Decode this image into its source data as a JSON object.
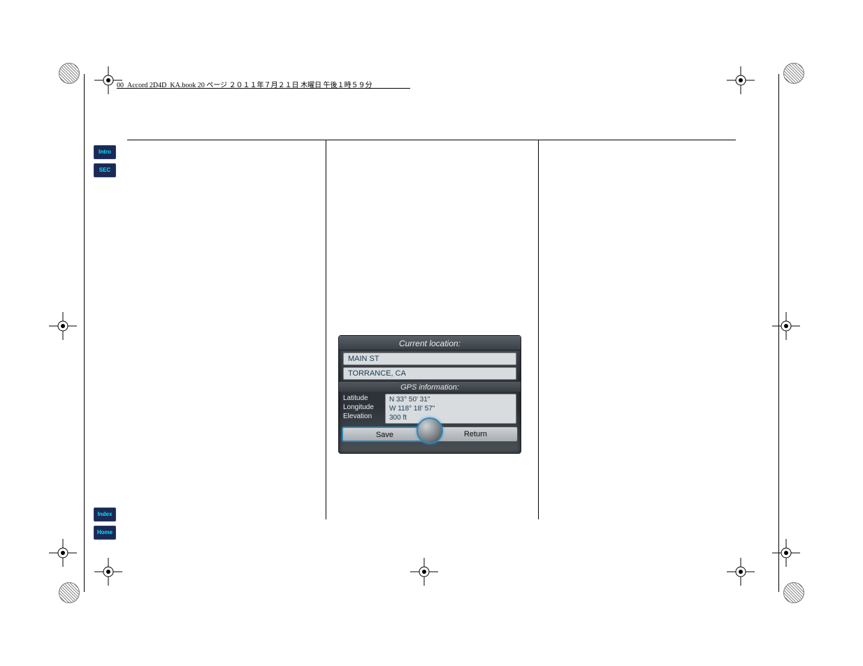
{
  "header": {
    "text": "00_Accord 2D4D_KA.book  20 ページ  ２０１１年７月２１日  木曜日  午後１時５９分"
  },
  "tabs": {
    "top": [
      "Intro",
      "SEC"
    ],
    "bottom": [
      "Index",
      "Home"
    ]
  },
  "gps": {
    "title": "Current location:",
    "street": "MAIN ST",
    "city": "TORRANCE, CA",
    "sub": "GPS information:",
    "labels": {
      "lat": "Latitude",
      "lon": "Longitude",
      "elev": "Elevation"
    },
    "values": {
      "lat": "N 33° 50' 31\"",
      "lon": "W 118° 18' 57\"",
      "elev": "300 ft"
    },
    "buttons": {
      "save": "Save",
      "return": "Return"
    }
  }
}
